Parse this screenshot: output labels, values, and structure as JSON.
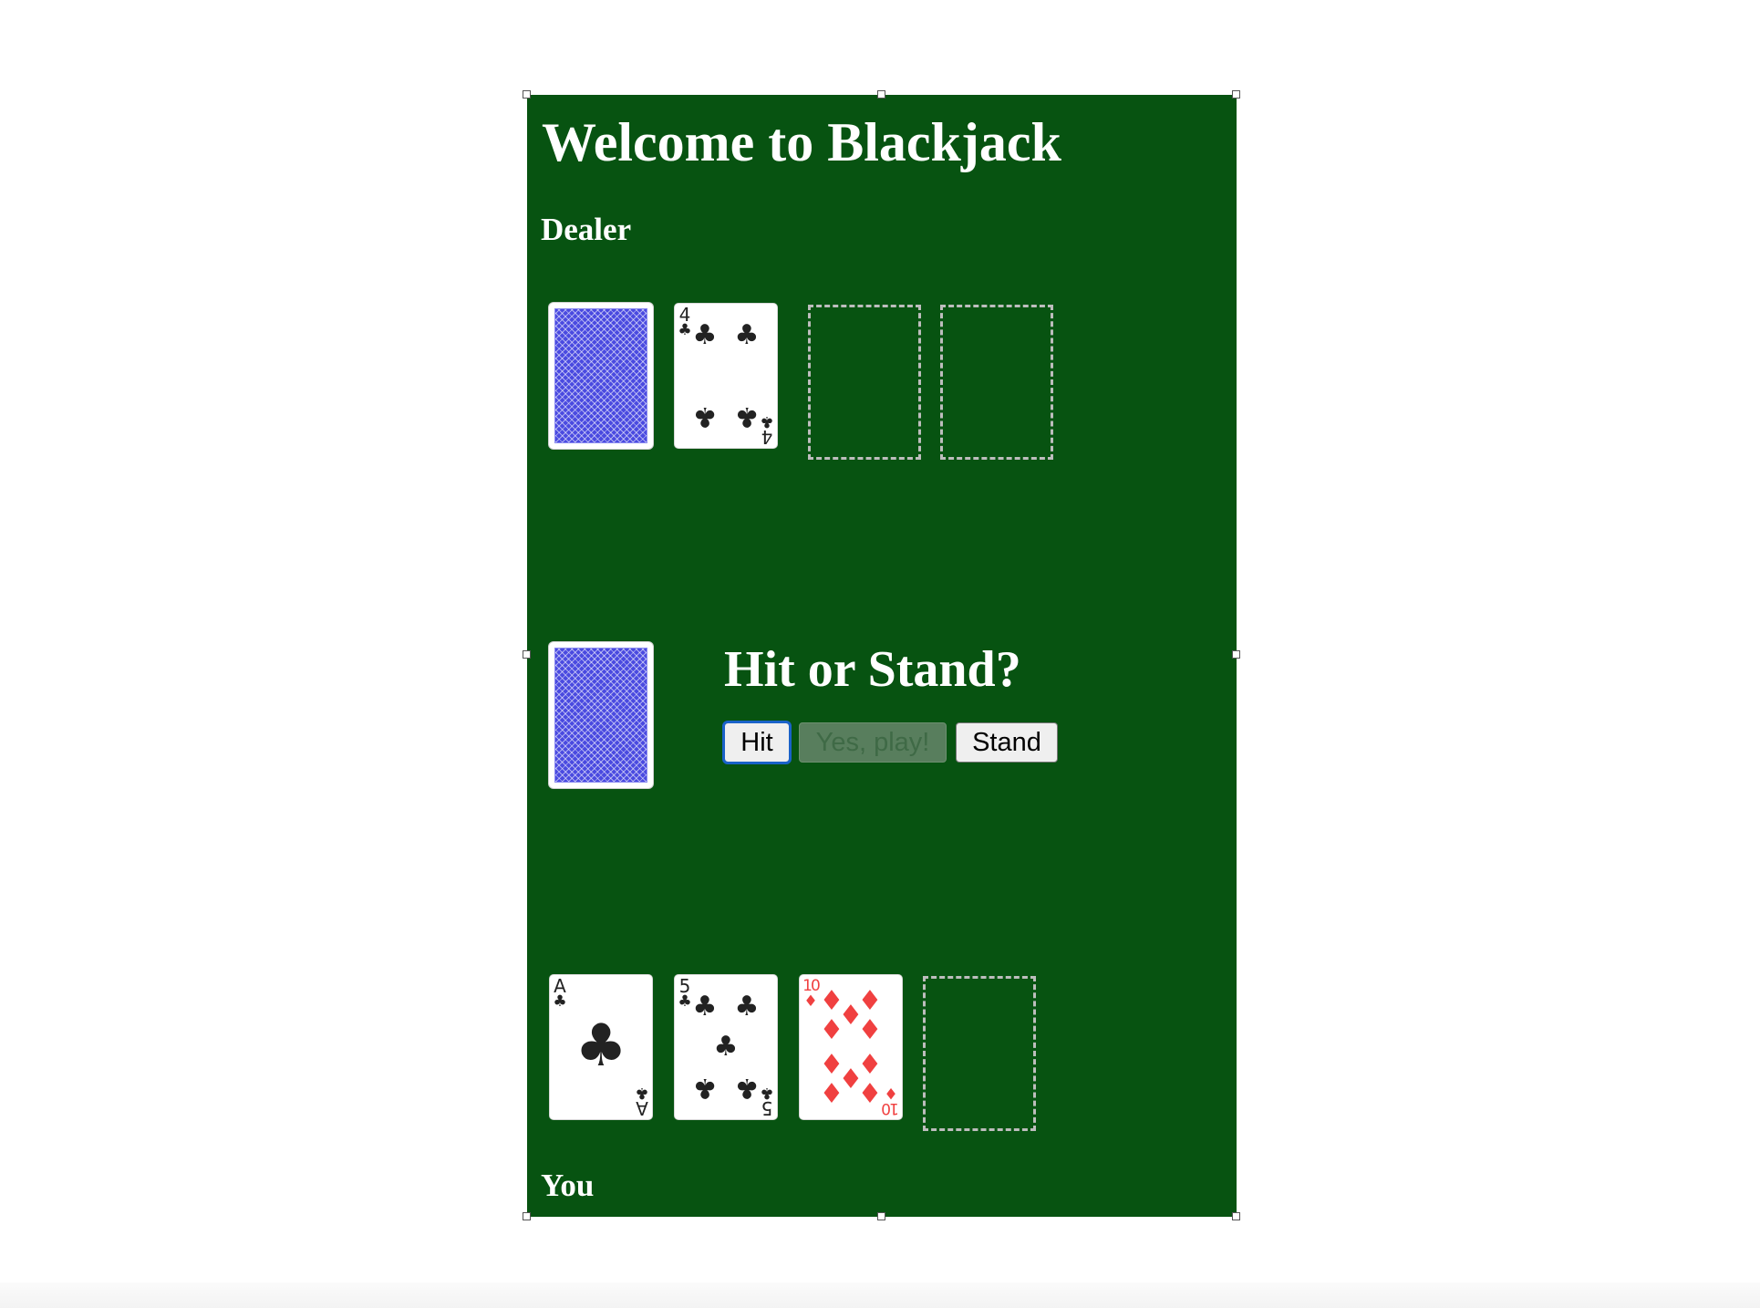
{
  "game": {
    "title": "Welcome to Blackjack",
    "dealer_label": "Dealer",
    "player_label": "You",
    "prompt": "Hit or Stand?",
    "colors": {
      "felt": "#075311",
      "card_back": "#4a4ae0",
      "black_suit": "#222222",
      "red_suit": "#f04040"
    }
  },
  "dealer": {
    "cards": [
      {
        "state": "face-down"
      },
      {
        "rank": "4",
        "suit": "♣",
        "suit_name": "clubs",
        "color": "black"
      }
    ],
    "empty_slots": 2
  },
  "deck": {
    "state": "face-down"
  },
  "player": {
    "cards": [
      {
        "rank": "A",
        "suit": "♣",
        "suit_name": "clubs",
        "color": "black"
      },
      {
        "rank": "5",
        "suit": "♣",
        "suit_name": "clubs",
        "color": "black"
      },
      {
        "rank": "10",
        "suit": "♦",
        "suit_name": "diamonds",
        "color": "red"
      }
    ],
    "empty_slots": 1
  },
  "controls": {
    "hit_label": "Hit",
    "play_label": "Yes, play!",
    "play_disabled": true,
    "stand_label": "Stand"
  }
}
